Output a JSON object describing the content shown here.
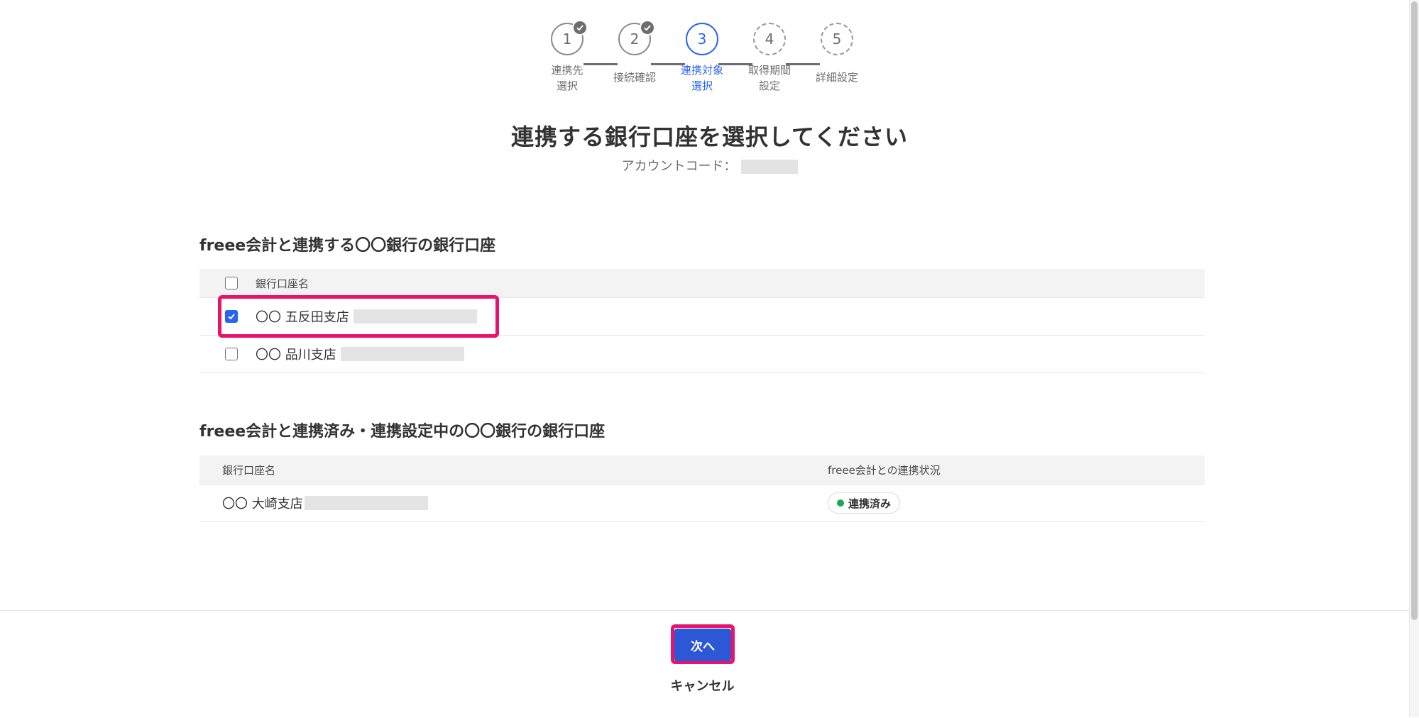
{
  "stepper": {
    "steps": [
      {
        "number": "1",
        "label": "連携先\n選択",
        "state": "done"
      },
      {
        "number": "2",
        "label": "接続確認",
        "state": "done"
      },
      {
        "number": "3",
        "label": "連携対象\n選択",
        "state": "active"
      },
      {
        "number": "4",
        "label": "取得期間\n設定",
        "state": "future"
      },
      {
        "number": "5",
        "label": "詳細設定",
        "state": "future"
      }
    ]
  },
  "header": {
    "title": "連携する銀行口座を選択してください",
    "account_code_label": "アカウントコード："
  },
  "section1": {
    "title": "freee会計と連携する〇〇銀行の銀行口座",
    "column_header": "銀行口座名",
    "rows": [
      {
        "name": "〇〇 五反田支店",
        "checked": true
      },
      {
        "name": "〇〇 品川支店",
        "checked": false
      }
    ]
  },
  "section2": {
    "title": "freee会計と連携済み・連携設定中の〇〇銀行の銀行口座",
    "column_headers": [
      "銀行口座名",
      "freee会計との連携状況"
    ],
    "rows": [
      {
        "name": "〇〇 大崎支店",
        "status": "連携済み"
      }
    ]
  },
  "footer": {
    "next_label": "次へ",
    "cancel_label": "キャンセル"
  },
  "colors": {
    "accent": "#2864f0",
    "button": "#2c58d6",
    "highlight": "#e8136b",
    "status_connected": "#1aa852"
  }
}
